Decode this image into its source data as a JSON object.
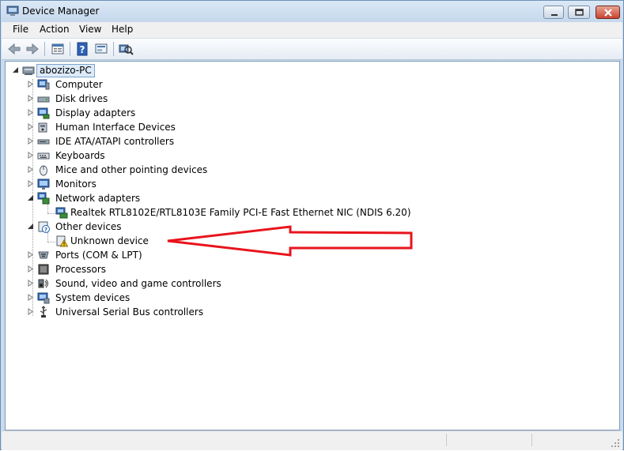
{
  "window": {
    "title": "Device Manager"
  },
  "menu": [
    "File",
    "Action",
    "View",
    "Help"
  ],
  "tree": {
    "root": "abozizo-PC",
    "categories": [
      {
        "label": "Computer",
        "icon": "computer-icon",
        "expanded": false
      },
      {
        "label": "Disk drives",
        "icon": "disk-drive-icon",
        "expanded": false
      },
      {
        "label": "Display adapters",
        "icon": "display-adapter-icon",
        "expanded": false
      },
      {
        "label": "Human Interface Devices",
        "icon": "hid-icon",
        "expanded": false
      },
      {
        "label": "IDE ATA/ATAPI controllers",
        "icon": "ide-controller-icon",
        "expanded": false
      },
      {
        "label": "Keyboards",
        "icon": "keyboard-icon",
        "expanded": false
      },
      {
        "label": "Mice and other pointing devices",
        "icon": "mouse-icon",
        "expanded": false
      },
      {
        "label": "Monitors",
        "icon": "monitor-icon",
        "expanded": false
      },
      {
        "label": "Network adapters",
        "icon": "network-adapter-icon",
        "expanded": true,
        "children": [
          "Realtek RTL8102E/RTL8103E Family PCI-E Fast Ethernet NIC (NDIS 6.20)"
        ]
      },
      {
        "label": "Other devices",
        "icon": "other-devices-icon",
        "expanded": true,
        "children": [
          "Unknown device"
        ]
      },
      {
        "label": "Ports (COM & LPT)",
        "icon": "port-icon",
        "expanded": false
      },
      {
        "label": "Processors",
        "icon": "processor-icon",
        "expanded": false
      },
      {
        "label": "Sound, video and game controllers",
        "icon": "sound-icon",
        "expanded": false
      },
      {
        "label": "System devices",
        "icon": "system-devices-icon",
        "expanded": false
      },
      {
        "label": "Universal Serial Bus controllers",
        "icon": "usb-icon",
        "expanded": false
      }
    ]
  },
  "annotation": {
    "arrow_color": "#e8141c"
  }
}
